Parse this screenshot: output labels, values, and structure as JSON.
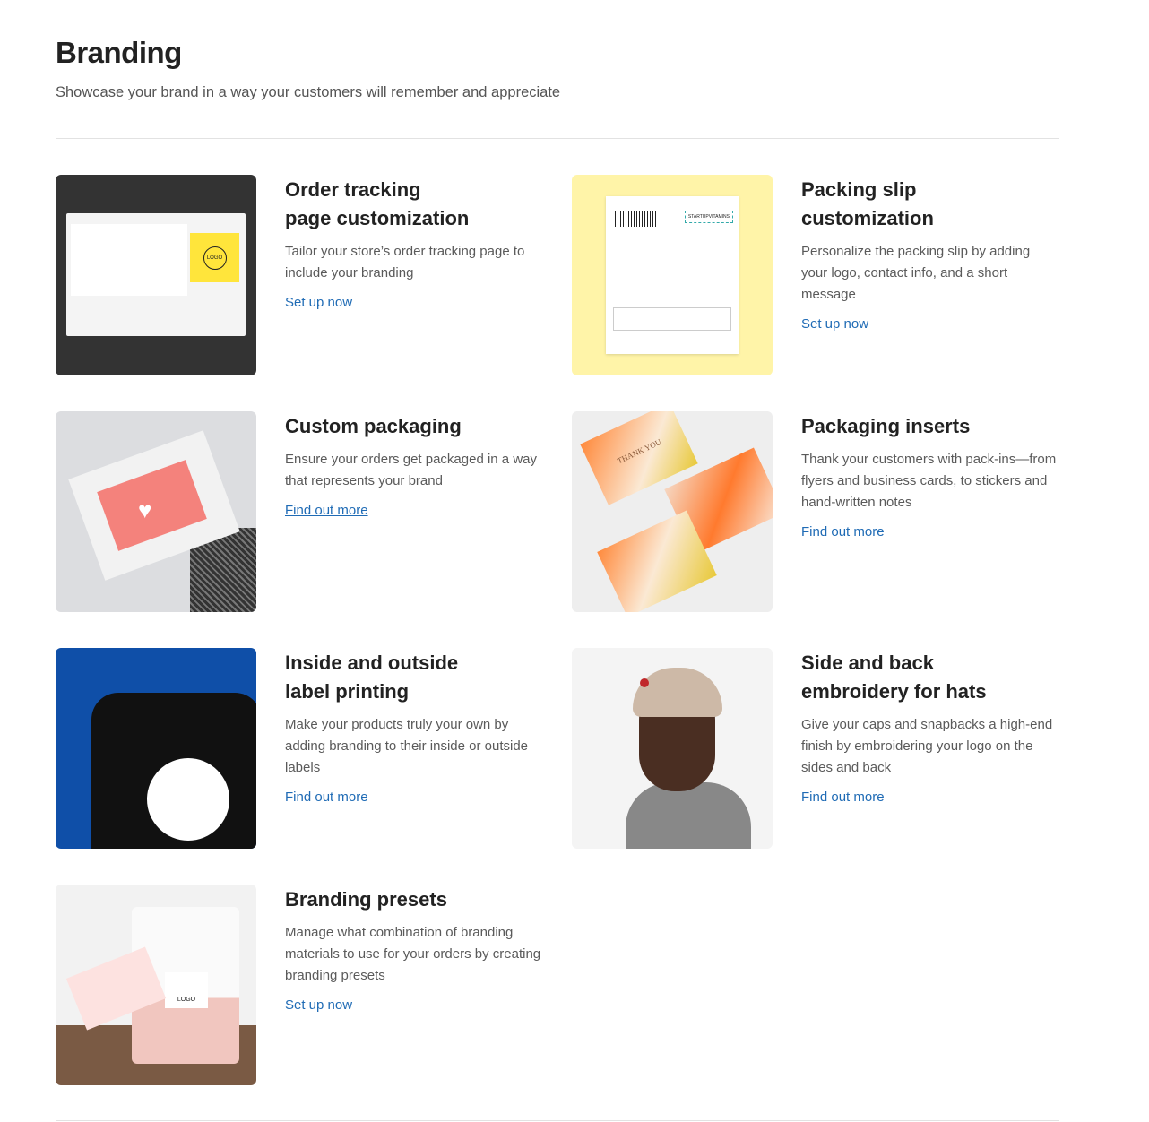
{
  "header": {
    "title": "Branding",
    "subtitle": "Showcase your brand in a way your customers will remember and appreciate"
  },
  "cards": [
    {
      "title_l1": "Order tracking",
      "title_l2": "page customization",
      "desc": "Tailor your store’s order tracking page to include your branding",
      "link": "Set up now",
      "image": "order-tracking-page-preview",
      "logo_text": "LOGO"
    },
    {
      "title_l1": "Packing slip",
      "title_l2": "customization",
      "desc": "Personalize the packing slip by adding your logo, contact info, and a short message",
      "link": "Set up now",
      "image": "packing-slip-preview",
      "logo_text": "STARTUPVITAMINS"
    },
    {
      "title_l1": "Custom packaging",
      "title_l2": "",
      "desc": "Ensure your orders get packaged in a way that represents your brand",
      "link": "Find out more",
      "image": "custom-mailer-packages"
    },
    {
      "title_l1": "Packaging inserts",
      "title_l2": "",
      "desc": "Thank your customers with pack-ins—from flyers and business cards, to stickers and hand-written notes",
      "link": "Find out more",
      "image": "thank-you-cards",
      "card_text": "THANK YOU"
    },
    {
      "title_l1": "Inside and outside",
      "title_l2": "label printing",
      "desc": "Make your products truly your own by adding branding to their inside or outside labels",
      "link": "Find out more",
      "image": "branded-t-shirts"
    },
    {
      "title_l1": "Side and back",
      "title_l2": "embroidery for hats",
      "desc": "Give your caps and snapbacks a high-end finish by embroidering your logo on the sides and back",
      "link": "Find out more",
      "image": "embroidered-cap-model"
    },
    {
      "title_l1": "Branding presets",
      "title_l2": "",
      "desc": "Manage what combination of branding materials to use for your orders by creating branding presets",
      "link": "Set up now",
      "image": "branded-pouch-and-card",
      "logo_text": "LOGO"
    }
  ],
  "colors": {
    "link": "#1f6bb5",
    "title": "#222222",
    "text": "#5a5a5a"
  }
}
